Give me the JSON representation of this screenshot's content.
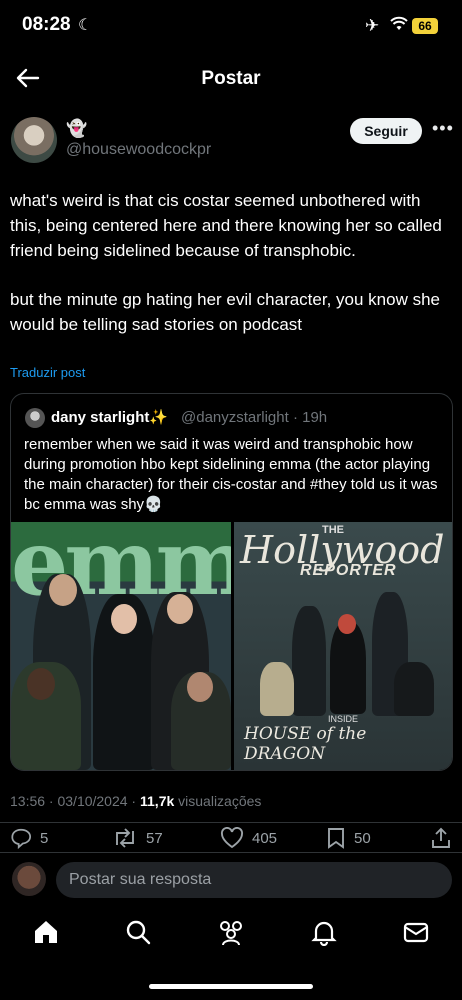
{
  "status": {
    "time": "08:28",
    "battery": "66"
  },
  "header": {
    "title": "Postar"
  },
  "author": {
    "handle": "@housewoodcockpr",
    "name_emoji": "👻",
    "follow_label": "Seguir"
  },
  "post": {
    "paragraph1": "what's weird is that cis costar seemed unbothered with this, being centered here and there knowing her so called friend being sidelined because of transphobic.",
    "paragraph2": "but the minute gp hating her evil character, you know she would be telling sad stories on podcast",
    "translate_label": "Traduzir post"
  },
  "quote": {
    "name": "dany starlight✨",
    "handle": "@danyzstarlight",
    "time": "· 19h",
    "text": "remember when we said it was weird and transphobic how during promotion hbo kept sidelining emma (the actor playing the main character) for their cis-costar and #they told us it was bc emma was shy💀",
    "image1_text": "emmy",
    "image2_the": "THE",
    "image2_title": "Hollywood",
    "image2_sub": "REPORTER",
    "image2_inside": "INSIDE",
    "image2_headline": "HOUSE of the DRAGON"
  },
  "meta": {
    "datetime": "13:56 · 03/10/2024 · ",
    "views_count": "11,7k",
    "views_label": " visualizações"
  },
  "actions": {
    "replies": "5",
    "reposts": "57",
    "likes": "405",
    "bookmarks": "50"
  },
  "reply": {
    "placeholder": "Postar sua resposta"
  },
  "tabs": [
    "home-icon",
    "search-icon",
    "communities-icon",
    "notifications-icon",
    "messages-icon"
  ]
}
